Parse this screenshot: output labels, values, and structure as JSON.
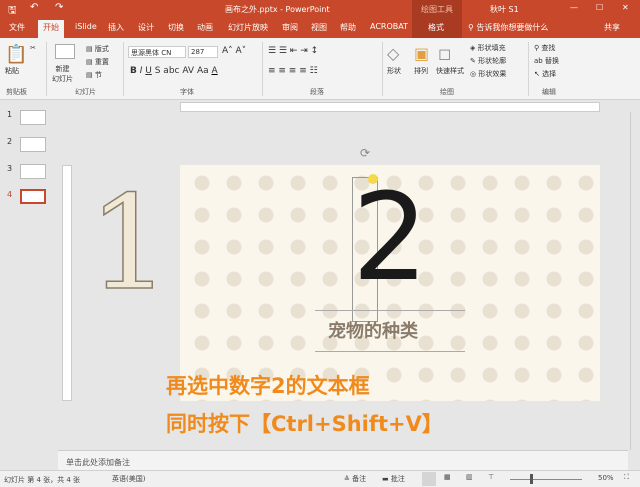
{
  "titlebar": {
    "doc_title": "画布之外.pptx - PowerPoint",
    "context_tools": "绘图工具",
    "user": "秋叶 S1"
  },
  "tabs": [
    "文件",
    "开始",
    "iSlide",
    "插入",
    "设计",
    "切换",
    "动画",
    "幻灯片放映",
    "审阅",
    "视图",
    "帮助",
    "ACROBAT",
    "格式"
  ],
  "tell_me": "告诉我你想要做什么",
  "share": "共享",
  "ribbon": {
    "paste": "粘贴",
    "new_slide": "新建\n幻灯片",
    "layout": "版式",
    "reset": "重置",
    "section": "节",
    "font_name": "思源黑体 CN",
    "font_size": "287",
    "shape": "形状",
    "arrange": "排列",
    "quick_styles": "快速样式",
    "fill": "形状填充",
    "outline": "形状轮廓",
    "effect": "形状效果",
    "find": "查找",
    "replace": "替换",
    "select": "选择",
    "groups": [
      "剪贴板",
      "幻灯片",
      "字体",
      "段落",
      "绘图",
      "编辑"
    ]
  },
  "thumbs": [
    "1",
    "2",
    "3",
    "4"
  ],
  "slide": {
    "big_number": "2",
    "side_number": "1",
    "subtitle": "宠物的种类"
  },
  "captions": [
    "再选中数字2的文本框",
    "同时按下【Ctrl+Shift+V】"
  ],
  "notes_placeholder": "单击此处添加备注",
  "status": {
    "slide_info": "幻灯片 第 4 张，共 4 张",
    "language": "英语(美国)",
    "notes": "备注",
    "comments": "批注",
    "zoom": "50%"
  }
}
